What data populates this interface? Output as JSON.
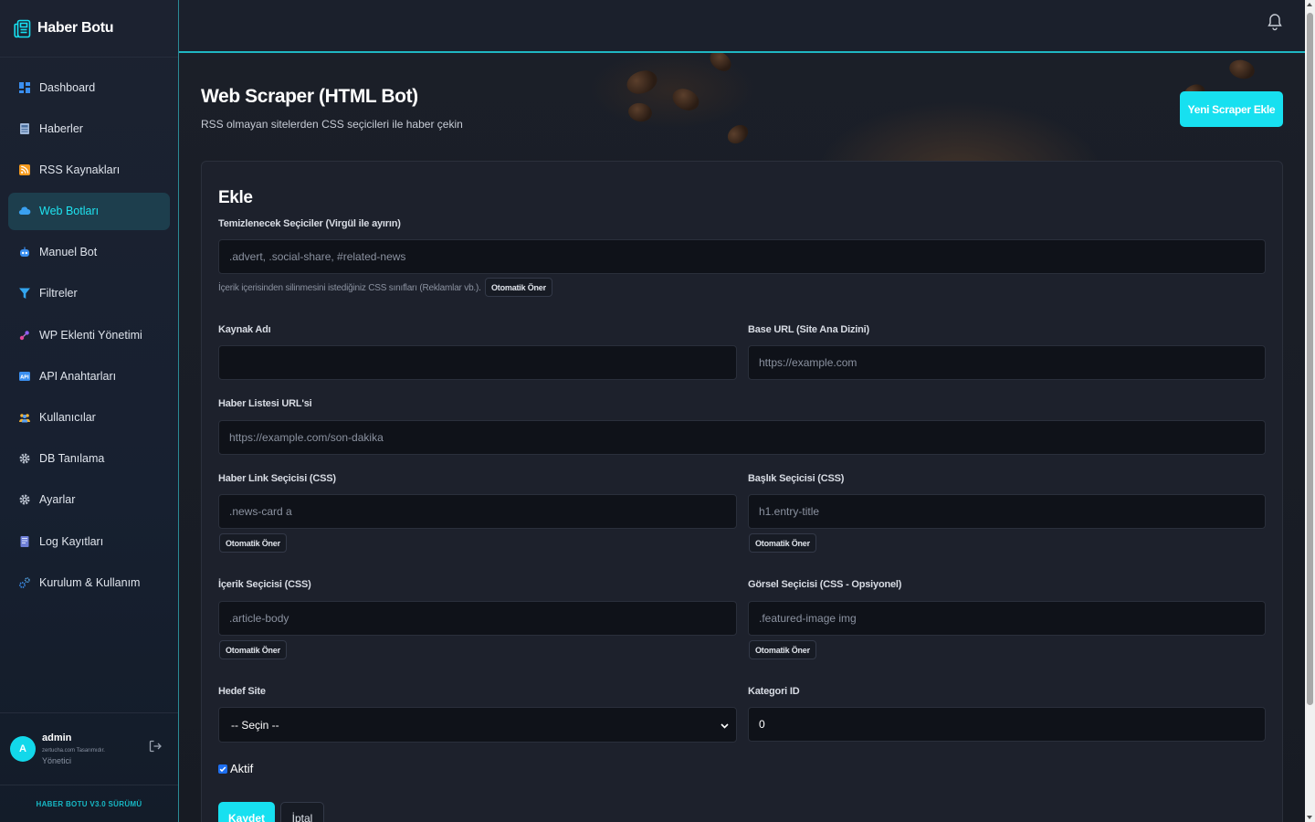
{
  "app": {
    "brand": "Haber Botu",
    "accent_color": "#17e0f0"
  },
  "sidebar": {
    "items": [
      {
        "label": "Dashboard",
        "icon": "dashboard-icon"
      },
      {
        "label": "Haberler",
        "icon": "newspaper-icon"
      },
      {
        "label": "RSS Kaynakları",
        "icon": "rss-icon"
      },
      {
        "label": "Web Botları",
        "icon": "cloud-icon",
        "active": true
      },
      {
        "label": "Manuel Bot",
        "icon": "robot-icon"
      },
      {
        "label": "Filtreler",
        "icon": "filter-icon"
      },
      {
        "label": "WP Eklenti Yönetimi",
        "icon": "plugin-icon"
      },
      {
        "label": "API Anahtarları",
        "icon": "api-icon"
      },
      {
        "label": "Kullanıcılar",
        "icon": "users-icon"
      },
      {
        "label": "DB Tanılama",
        "icon": "gear-icon"
      },
      {
        "label": "Ayarlar",
        "icon": "gear-icon"
      },
      {
        "label": "Log Kayıtları",
        "icon": "log-icon"
      },
      {
        "label": "Kurulum & Kullanım",
        "icon": "gears-icon"
      }
    ],
    "user": {
      "initial": "A",
      "name": "admin",
      "credit": "zertucha.com Tasarımıdır.",
      "role": "Yönetici"
    },
    "version": "HABER BOTU V3.0 SÜRÜMÜ"
  },
  "page": {
    "title": "Web Scraper (HTML Bot)",
    "subtitle": "RSS olmayan sitelerden CSS seçicileri ile haber çekin",
    "new_button": "Yeni Scraper Ekle"
  },
  "form": {
    "title": "Ekle",
    "clean_selectors": {
      "label": "Temizlenecek Seçiciler (Virgül ile ayırın)",
      "placeholder": ".advert, .social-share, #related-news",
      "hint": "İçerik içerisinden silinmesini istediğiniz CSS sınıfları (Reklamlar vb.).",
      "auto": "Otomatik Öner"
    },
    "source_name": {
      "label": "Kaynak Adı",
      "value": ""
    },
    "base_url": {
      "label": "Base URL (Site Ana Dizini)",
      "placeholder": "https://example.com"
    },
    "list_url": {
      "label": "Haber Listesi URL'si",
      "placeholder": "https://example.com/son-dakika"
    },
    "link_selector": {
      "label": "Haber Link Seçicisi (CSS)",
      "placeholder": ".news-card a",
      "auto": "Otomatik Öner"
    },
    "title_selector": {
      "label": "Başlık Seçicisi (CSS)",
      "placeholder": "h1.entry-title",
      "auto": "Otomatik Öner"
    },
    "content_selector": {
      "label": "İçerik Seçicisi (CSS)",
      "placeholder": ".article-body",
      "auto": "Otomatik Öner"
    },
    "image_selector": {
      "label": "Görsel Seçicisi (CSS - Opsiyonel)",
      "placeholder": ".featured-image img",
      "auto": "Otomatik Öner"
    },
    "target_site": {
      "label": "Hedef Site",
      "selected": "-- Seçin --"
    },
    "category_id": {
      "label": "Kategori ID",
      "value": "0"
    },
    "active": {
      "label": "Aktif",
      "checked": true
    },
    "save": "Kaydet",
    "cancel": "İptal"
  }
}
